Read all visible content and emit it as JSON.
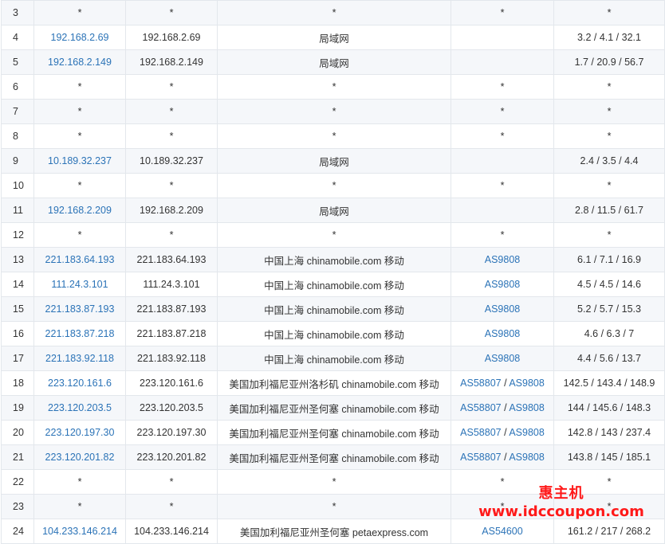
{
  "hops": [
    {
      "hop": "3",
      "ip": "*",
      "host": "*",
      "location": "*",
      "asn": [
        "*"
      ],
      "latency": "*",
      "link": false
    },
    {
      "hop": "4",
      "ip": "192.168.2.69",
      "host": "192.168.2.69",
      "location": "局域网",
      "asn": [],
      "latency": "3.2 / 4.1 / 32.1",
      "link": true
    },
    {
      "hop": "5",
      "ip": "192.168.2.149",
      "host": "192.168.2.149",
      "location": "局域网",
      "asn": [],
      "latency": "1.7 / 20.9 / 56.7",
      "link": true
    },
    {
      "hop": "6",
      "ip": "*",
      "host": "*",
      "location": "*",
      "asn": [
        "*"
      ],
      "latency": "*",
      "link": false
    },
    {
      "hop": "7",
      "ip": "*",
      "host": "*",
      "location": "*",
      "asn": [
        "*"
      ],
      "latency": "*",
      "link": false
    },
    {
      "hop": "8",
      "ip": "*",
      "host": "*",
      "location": "*",
      "asn": [
        "*"
      ],
      "latency": "*",
      "link": false
    },
    {
      "hop": "9",
      "ip": "10.189.32.237",
      "host": "10.189.32.237",
      "location": "局域网",
      "asn": [],
      "latency": "2.4 / 3.5 / 4.4",
      "link": true
    },
    {
      "hop": "10",
      "ip": "*",
      "host": "*",
      "location": "*",
      "asn": [
        "*"
      ],
      "latency": "*",
      "link": false
    },
    {
      "hop": "11",
      "ip": "192.168.2.209",
      "host": "192.168.2.209",
      "location": "局域网",
      "asn": [],
      "latency": "2.8 / 11.5 / 61.7",
      "link": true
    },
    {
      "hop": "12",
      "ip": "*",
      "host": "*",
      "location": "*",
      "asn": [
        "*"
      ],
      "latency": "*",
      "link": false
    },
    {
      "hop": "13",
      "ip": "221.183.64.193",
      "host": "221.183.64.193",
      "location": "中国上海 chinamobile.com 移动",
      "asn": [
        "AS9808"
      ],
      "latency": "6.1 / 7.1 / 16.9",
      "link": true
    },
    {
      "hop": "14",
      "ip": "111.24.3.101",
      "host": "111.24.3.101",
      "location": "中国上海 chinamobile.com 移动",
      "asn": [
        "AS9808"
      ],
      "latency": "4.5 / 4.5 / 14.6",
      "link": true
    },
    {
      "hop": "15",
      "ip": "221.183.87.193",
      "host": "221.183.87.193",
      "location": "中国上海 chinamobile.com 移动",
      "asn": [
        "AS9808"
      ],
      "latency": "5.2 / 5.7 / 15.3",
      "link": true
    },
    {
      "hop": "16",
      "ip": "221.183.87.218",
      "host": "221.183.87.218",
      "location": "中国上海 chinamobile.com 移动",
      "asn": [
        "AS9808"
      ],
      "latency": "4.6 / 6.3 / 7",
      "link": true
    },
    {
      "hop": "17",
      "ip": "221.183.92.118",
      "host": "221.183.92.118",
      "location": "中国上海 chinamobile.com 移动",
      "asn": [
        "AS9808"
      ],
      "latency": "4.4 / 5.6 / 13.7",
      "link": true
    },
    {
      "hop": "18",
      "ip": "223.120.161.6",
      "host": "223.120.161.6",
      "location": "美国加利福尼亚州洛杉矶 chinamobile.com 移动",
      "asn": [
        "AS58807",
        "AS9808"
      ],
      "latency": "142.5 / 143.4 / 148.9",
      "link": true
    },
    {
      "hop": "19",
      "ip": "223.120.203.5",
      "host": "223.120.203.5",
      "location": "美国加利福尼亚州圣何塞 chinamobile.com 移动",
      "asn": [
        "AS58807",
        "AS9808"
      ],
      "latency": "144 / 145.6 / 148.3",
      "link": true
    },
    {
      "hop": "20",
      "ip": "223.120.197.30",
      "host": "223.120.197.30",
      "location": "美国加利福尼亚州圣何塞 chinamobile.com 移动",
      "asn": [
        "AS58807",
        "AS9808"
      ],
      "latency": "142.8 / 143 / 237.4",
      "link": true
    },
    {
      "hop": "21",
      "ip": "223.120.201.82",
      "host": "223.120.201.82",
      "location": "美国加利福尼亚州圣何塞 chinamobile.com 移动",
      "asn": [
        "AS58807",
        "AS9808"
      ],
      "latency": "143.8 / 145 / 185.1",
      "link": true
    },
    {
      "hop": "22",
      "ip": "*",
      "host": "*",
      "location": "*",
      "asn": [
        "*"
      ],
      "latency": "*",
      "link": false
    },
    {
      "hop": "23",
      "ip": "*",
      "host": "*",
      "location": "*",
      "asn": [
        "*"
      ],
      "latency": "*",
      "link": false
    },
    {
      "hop": "24",
      "ip": "104.233.146.214",
      "host": "104.233.146.214",
      "location": "美国加利福尼亚州圣何塞 petaexpress.com",
      "asn": [
        "AS54600"
      ],
      "latency": "161.2 / 217 / 268.2",
      "link": true
    }
  ],
  "asn_separator": " / ",
  "watermark": {
    "title": "惠主机",
    "url": "www.idccoupon.com"
  },
  "colors": {
    "link": "#2b73b7",
    "row_alt": "#f5f7fa",
    "border": "#e3e7ec",
    "watermark": "#ff1a1a"
  }
}
